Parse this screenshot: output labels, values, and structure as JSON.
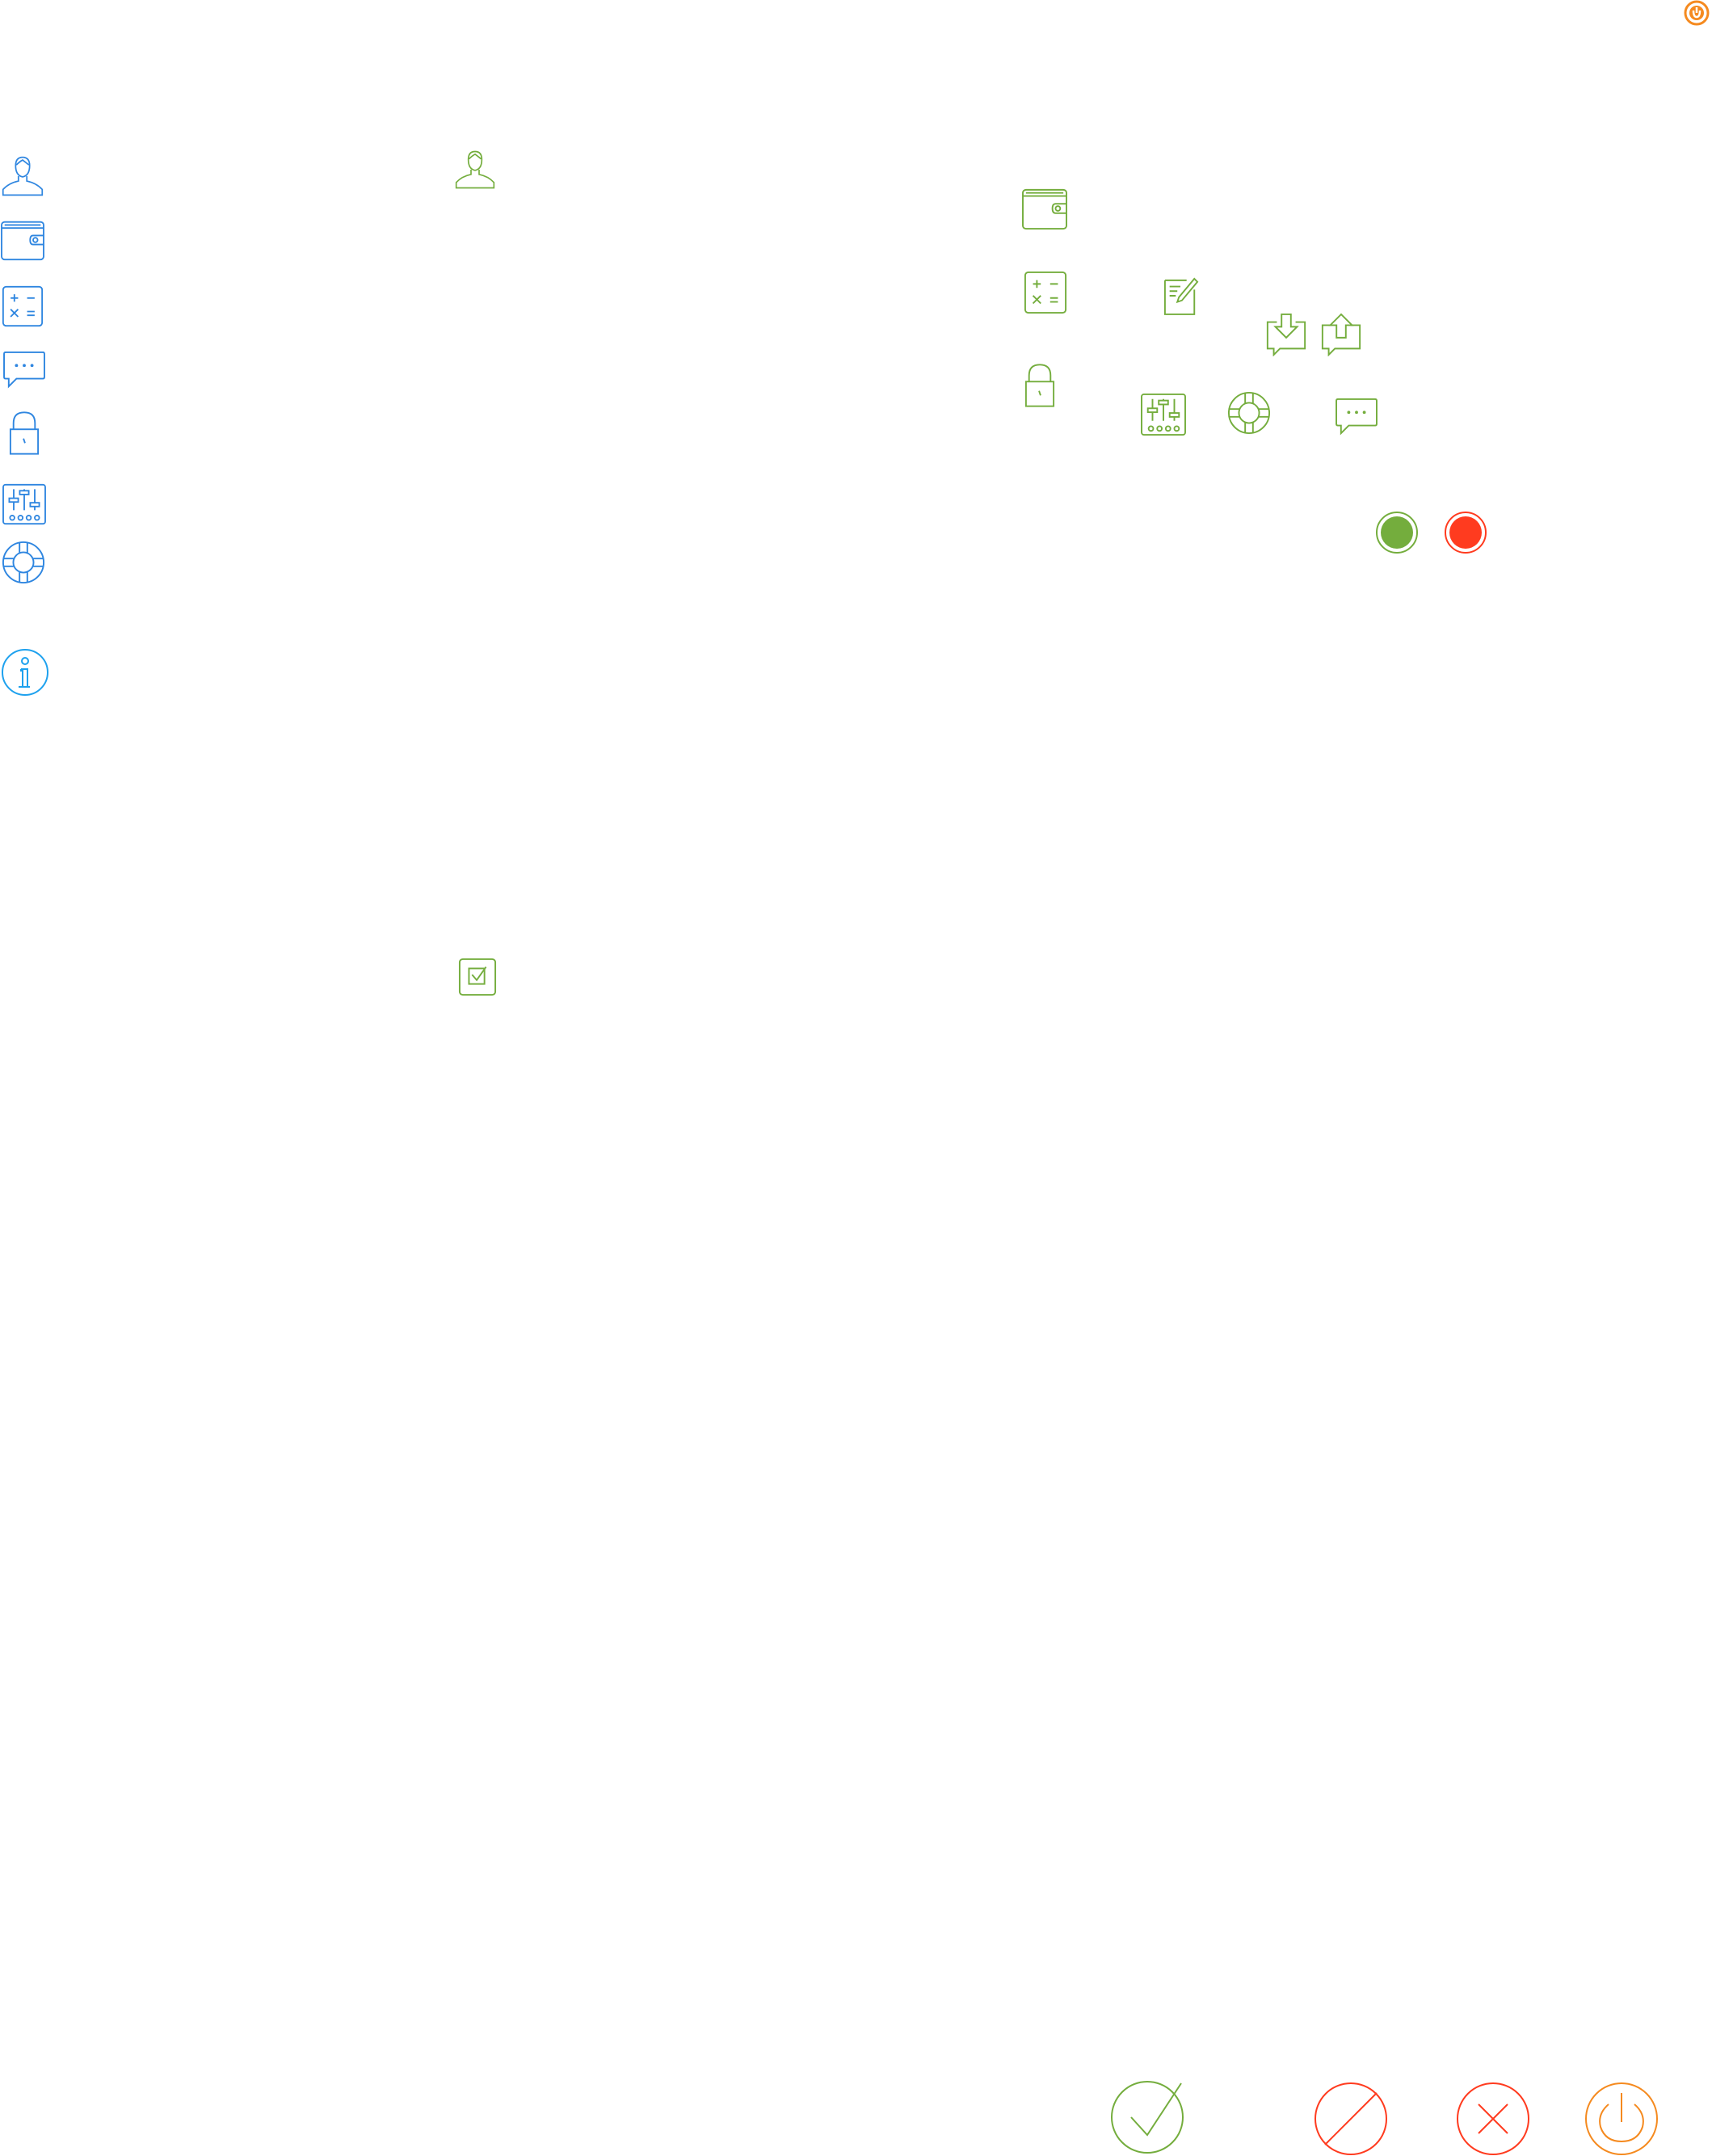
{
  "palette": {
    "blue": "#2f86e0",
    "light_blue": "#1ea1ee",
    "green": "#74ad3d",
    "red": "#ff3b1f",
    "orange": "#f58a1f"
  },
  "top_right": {
    "icon": "power-badge-icon"
  },
  "sidebar": {
    "items": [
      {
        "icon": "user-icon"
      },
      {
        "icon": "wallet-icon"
      },
      {
        "icon": "calculator-icon"
      },
      {
        "icon": "chat-bubble-icon"
      },
      {
        "icon": "lock-icon"
      },
      {
        "icon": "sliders-icon"
      },
      {
        "icon": "lifebuoy-icon"
      },
      {
        "icon": "info-icon"
      }
    ]
  },
  "green_set": {
    "items": [
      "user-icon",
      "checkbox-icon",
      "wallet-icon",
      "calculator-icon",
      "edit-note-icon",
      "inbox-download-icon",
      "outbox-upload-icon",
      "lock-icon",
      "sliders-icon",
      "lifebuoy-icon",
      "chat-bubble-icon"
    ]
  },
  "status_dots": {
    "items": [
      "online-status-icon",
      "offline-status-icon"
    ]
  },
  "large_actions": {
    "items": [
      "confirm-check-icon",
      "block-icon",
      "close-x-icon",
      "power-icon"
    ]
  }
}
